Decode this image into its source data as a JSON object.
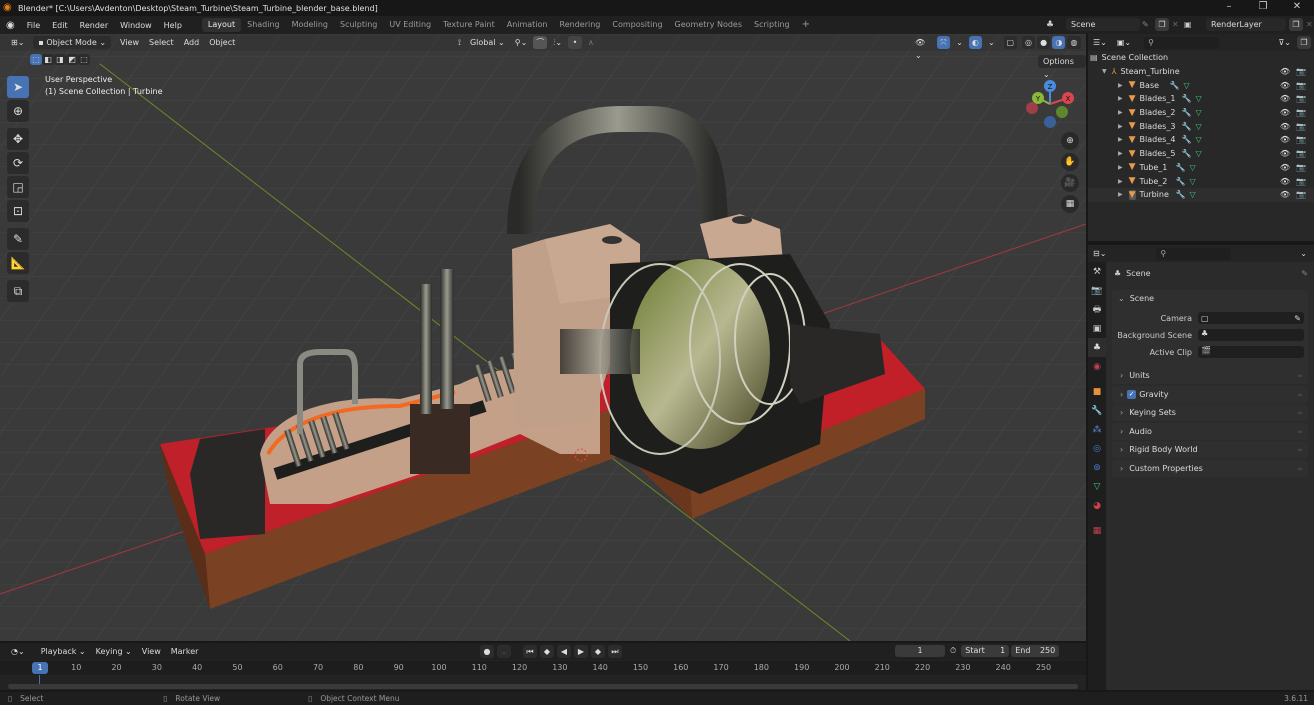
{
  "window": {
    "title": "Blender* [C:\\Users\\Avdenton\\Desktop\\Steam_Turbine\\Steam_Turbine_blender_base.blend]",
    "controls": [
      "minimize-icon",
      "restore-icon",
      "close-icon"
    ]
  },
  "menubar": {
    "items": [
      "File",
      "Edit",
      "Render",
      "Window",
      "Help"
    ],
    "workspaces": [
      "Layout",
      "Shading",
      "Modeling",
      "Sculpting",
      "UV Editing",
      "Texture Paint",
      "Animation",
      "Rendering",
      "Compositing",
      "Geometry Nodes",
      "Scripting"
    ],
    "active_workspace": "Layout",
    "add_workspace": "+",
    "scene": "Scene",
    "view_layer": "RenderLayer"
  },
  "viewport": {
    "mode": "Object Mode",
    "menus": [
      "View",
      "Select",
      "Add",
      "Object"
    ],
    "transform_orientation": "Global",
    "options_label": "Options",
    "overlay_line1": "User Perspective",
    "overlay_line2": "(1) Scene Collection | Turbine",
    "gizmo_axes": {
      "x": "X",
      "y": "Y",
      "z": "Z"
    },
    "colors": {
      "background": "#3b3b3b",
      "grid": "#4a4a4a",
      "x_axis": "#c4444a",
      "y_axis": "#7b9a2a",
      "base_top": "#c0202a",
      "base_side": "#7a4222"
    }
  },
  "outliner": {
    "root": "Scene Collection",
    "collection": "Steam_Turbine",
    "objects": [
      {
        "name": "Base"
      },
      {
        "name": "Blades_1"
      },
      {
        "name": "Blades_2"
      },
      {
        "name": "Blades_3"
      },
      {
        "name": "Blades_4"
      },
      {
        "name": "Blades_5"
      },
      {
        "name": "Tube_1"
      },
      {
        "name": "Tube_2"
      },
      {
        "name": "Turbine"
      }
    ]
  },
  "properties": {
    "context": "Scene",
    "section_scene": "Scene",
    "camera_label": "Camera",
    "background_scene_label": "Background Scene",
    "active_clip_label": "Active Clip",
    "panels": [
      {
        "label": "Units",
        "checkbox": false
      },
      {
        "label": "Gravity",
        "checkbox": true
      },
      {
        "label": "Keying Sets",
        "checkbox": false
      },
      {
        "label": "Audio",
        "checkbox": false
      },
      {
        "label": "Rigid Body World",
        "checkbox": false
      },
      {
        "label": "Custom Properties",
        "checkbox": false
      }
    ]
  },
  "timeline": {
    "menus": [
      "Playback",
      "Keying",
      "View",
      "Marker"
    ],
    "current_frame": "1",
    "start_label": "Start",
    "start": "1",
    "end_label": "End",
    "end": "250",
    "ticks": [
      "10",
      "20",
      "30",
      "40",
      "50",
      "60",
      "70",
      "80",
      "90",
      "100",
      "110",
      "120",
      "130",
      "140",
      "150",
      "160",
      "170",
      "180",
      "190",
      "200",
      "210",
      "220",
      "230",
      "240",
      "250"
    ]
  },
  "statusbar": {
    "hints": [
      "Select",
      "Rotate View",
      "Object Context Menu"
    ],
    "version": "3.6.11"
  }
}
